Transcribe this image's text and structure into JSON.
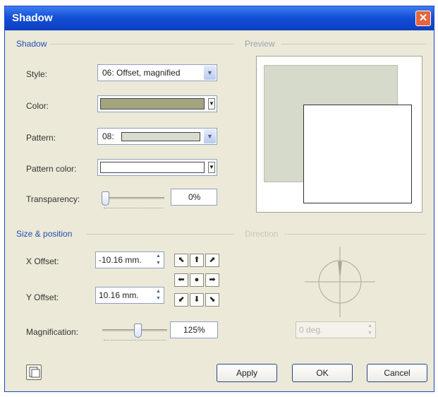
{
  "window": {
    "title": "Shadow",
    "close_glyph": "✕"
  },
  "shadow_group": {
    "title": "Shadow",
    "style": {
      "label": "Style:",
      "value": "06: Offset, magnified"
    },
    "color": {
      "label": "Color:",
      "swatch": "#a3a57e"
    },
    "pattern": {
      "label": "Pattern:",
      "value": "08:",
      "swatch": "#d8dccf"
    },
    "pattern_color": {
      "label": "Pattern color:",
      "swatch": "#ffffff"
    },
    "transparency": {
      "label": "Transparency:",
      "value": "0%",
      "level": 0
    }
  },
  "preview_group": {
    "title": "Preview",
    "shadow_color": "#d6dacb",
    "shape_color": "#ffffff"
  },
  "size_group": {
    "title": "Size & position",
    "x_offset": {
      "label": "X Offset:",
      "value": "-10.16 mm."
    },
    "y_offset": {
      "label": "Y Offset:",
      "value": "10.16 mm."
    },
    "magnification": {
      "label": "Magnification:",
      "value": "125%"
    },
    "nudge": [
      "⬉",
      "⬆",
      "⬈",
      "⬅",
      "●",
      "➡",
      "⬋",
      "⬇",
      "⬊"
    ]
  },
  "direction_group": {
    "title": "Direction",
    "value": "0 deg."
  },
  "buttons": {
    "apply": "Apply",
    "ok": "OK",
    "cancel": "Cancel"
  }
}
